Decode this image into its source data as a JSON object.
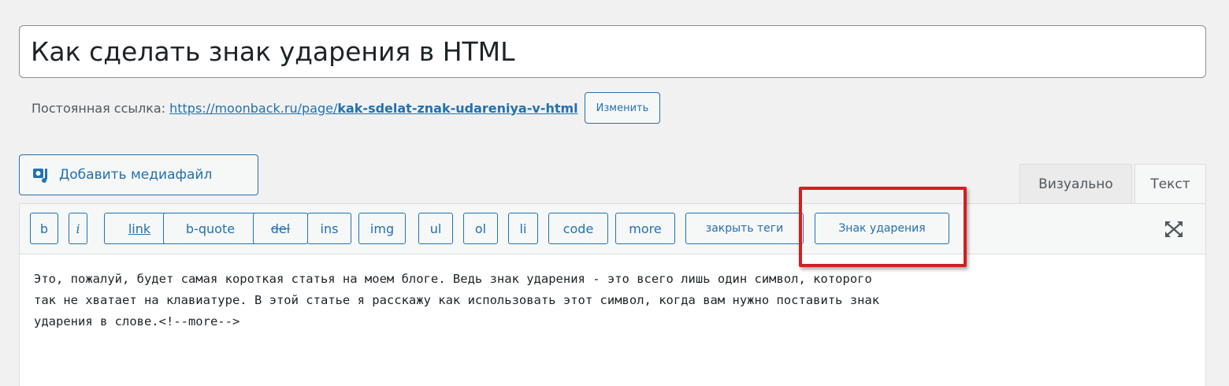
{
  "post_title": "Как сделать знак ударения в HTML",
  "permalink": {
    "label": "Постоянная ссылка:",
    "base_url": "https://moonback.ru/page/",
    "slug": "kak-sdelat-znak-udareniya-v-html",
    "edit_button": "Изменить"
  },
  "media_button": {
    "label": "Добавить медиафайл",
    "icon": "media-camera-icon"
  },
  "tabs": {
    "visual": "Визуально",
    "text": "Текст",
    "active": "text"
  },
  "quicktags": {
    "b": "b",
    "i": "i",
    "link": "link",
    "bquote": "b-quote",
    "del": "del",
    "ins": "ins",
    "img": "img",
    "ul": "ul",
    "ol": "ol",
    "li": "li",
    "code": "code",
    "more": "more",
    "close": "закрыть теги",
    "accent": "Знак ударения"
  },
  "fullscreen_icon": "fullscreen-icon",
  "content_lines": [
    "Это, пожалуй, будет самая короткая статья на моем блоге. Ведь знак ударения - это всего лишь один символ, которого",
    "так не хватает на клавиатуре. В этой статье я расскажу как использовать этот символ, когда вам нужно поставить знак",
    "ударения в слове.<!--more-->"
  ],
  "colors": {
    "accent": "#2271b1",
    "highlight": "#d02020"
  }
}
